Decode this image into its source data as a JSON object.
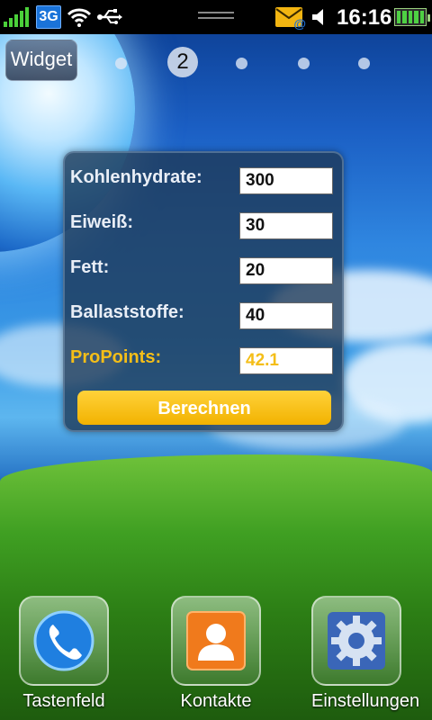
{
  "status_bar": {
    "network": "3G",
    "time": "16:16",
    "icons": [
      "signal-icon",
      "3g-icon",
      "wifi-icon",
      "usb-icon",
      "mail-icon",
      "volume-icon",
      "battery-icon"
    ]
  },
  "home": {
    "widget_button": "Widget",
    "current_page": "2"
  },
  "calculator": {
    "rows": [
      {
        "label": "Kohlenhydrate:",
        "value": "300"
      },
      {
        "label": "Eiweiß:",
        "value": "30"
      },
      {
        "label": "Fett:",
        "value": "20"
      },
      {
        "label": "Ballaststoffe:",
        "value": "40"
      }
    ],
    "result": {
      "label": "ProPoints:",
      "value": "42.1"
    },
    "button": "Berechnen"
  },
  "dock": [
    {
      "label": "Tastenfeld",
      "icon": "phone-icon"
    },
    {
      "label": "Kontakte",
      "icon": "contacts-icon"
    },
    {
      "label": "Einstellungen",
      "icon": "settings-gear-icon"
    }
  ],
  "colors": {
    "accent": "#f4be18",
    "panel": "#1e3755",
    "status_bar": "#000000"
  }
}
